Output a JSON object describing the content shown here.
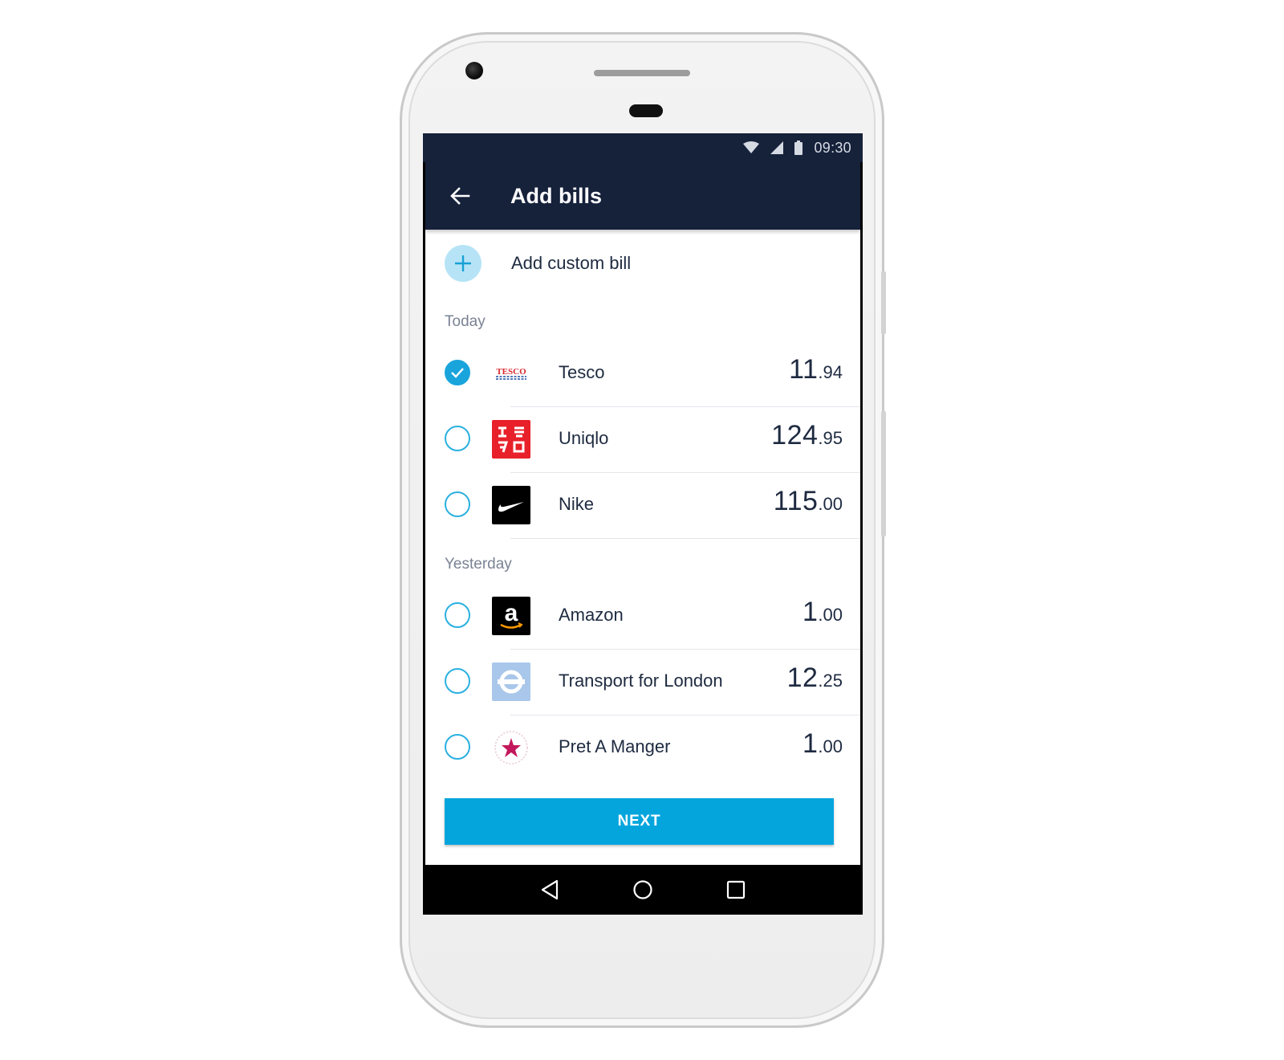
{
  "statusbar": {
    "time": "09:30",
    "icons": [
      "wifi-icon",
      "signal-icon",
      "battery-icon"
    ]
  },
  "appbar": {
    "title": "Add bills",
    "back_icon": "arrow-left-icon"
  },
  "add_custom": {
    "label": "Add custom bill",
    "icon": "plus-icon"
  },
  "sections": [
    {
      "label": "Today",
      "bills": [
        {
          "name": "Tesco",
          "amount_major": "11",
          "amount_minor": ".94",
          "selected": true,
          "logo": "tesco-logo"
        },
        {
          "name": "Uniqlo",
          "amount_major": "124",
          "amount_minor": ".95",
          "selected": false,
          "logo": "uniqlo-logo"
        },
        {
          "name": "Nike",
          "amount_major": "115",
          "amount_minor": ".00",
          "selected": false,
          "logo": "nike-logo"
        }
      ]
    },
    {
      "label": "Yesterday",
      "bills": [
        {
          "name": "Amazon",
          "amount_major": "1",
          "amount_minor": ".00",
          "selected": false,
          "logo": "amazon-logo"
        },
        {
          "name": "Transport for London",
          "amount_major": "12",
          "amount_minor": ".25",
          "selected": false,
          "logo": "tfl-logo"
        },
        {
          "name": "Pret A Manger",
          "amount_major": "1",
          "amount_minor": ".00",
          "selected": false,
          "logo": "pret-logo"
        }
      ]
    }
  ],
  "footer": {
    "next_label": "NEXT"
  },
  "logo_text": {
    "tesco": "TESCO",
    "amazon": "a"
  },
  "colors": {
    "primary_dark": "#16213a",
    "accent": "#04a5dd",
    "check": "#1aa4dc",
    "text": "#1e2a40",
    "muted": "#7a8294"
  }
}
